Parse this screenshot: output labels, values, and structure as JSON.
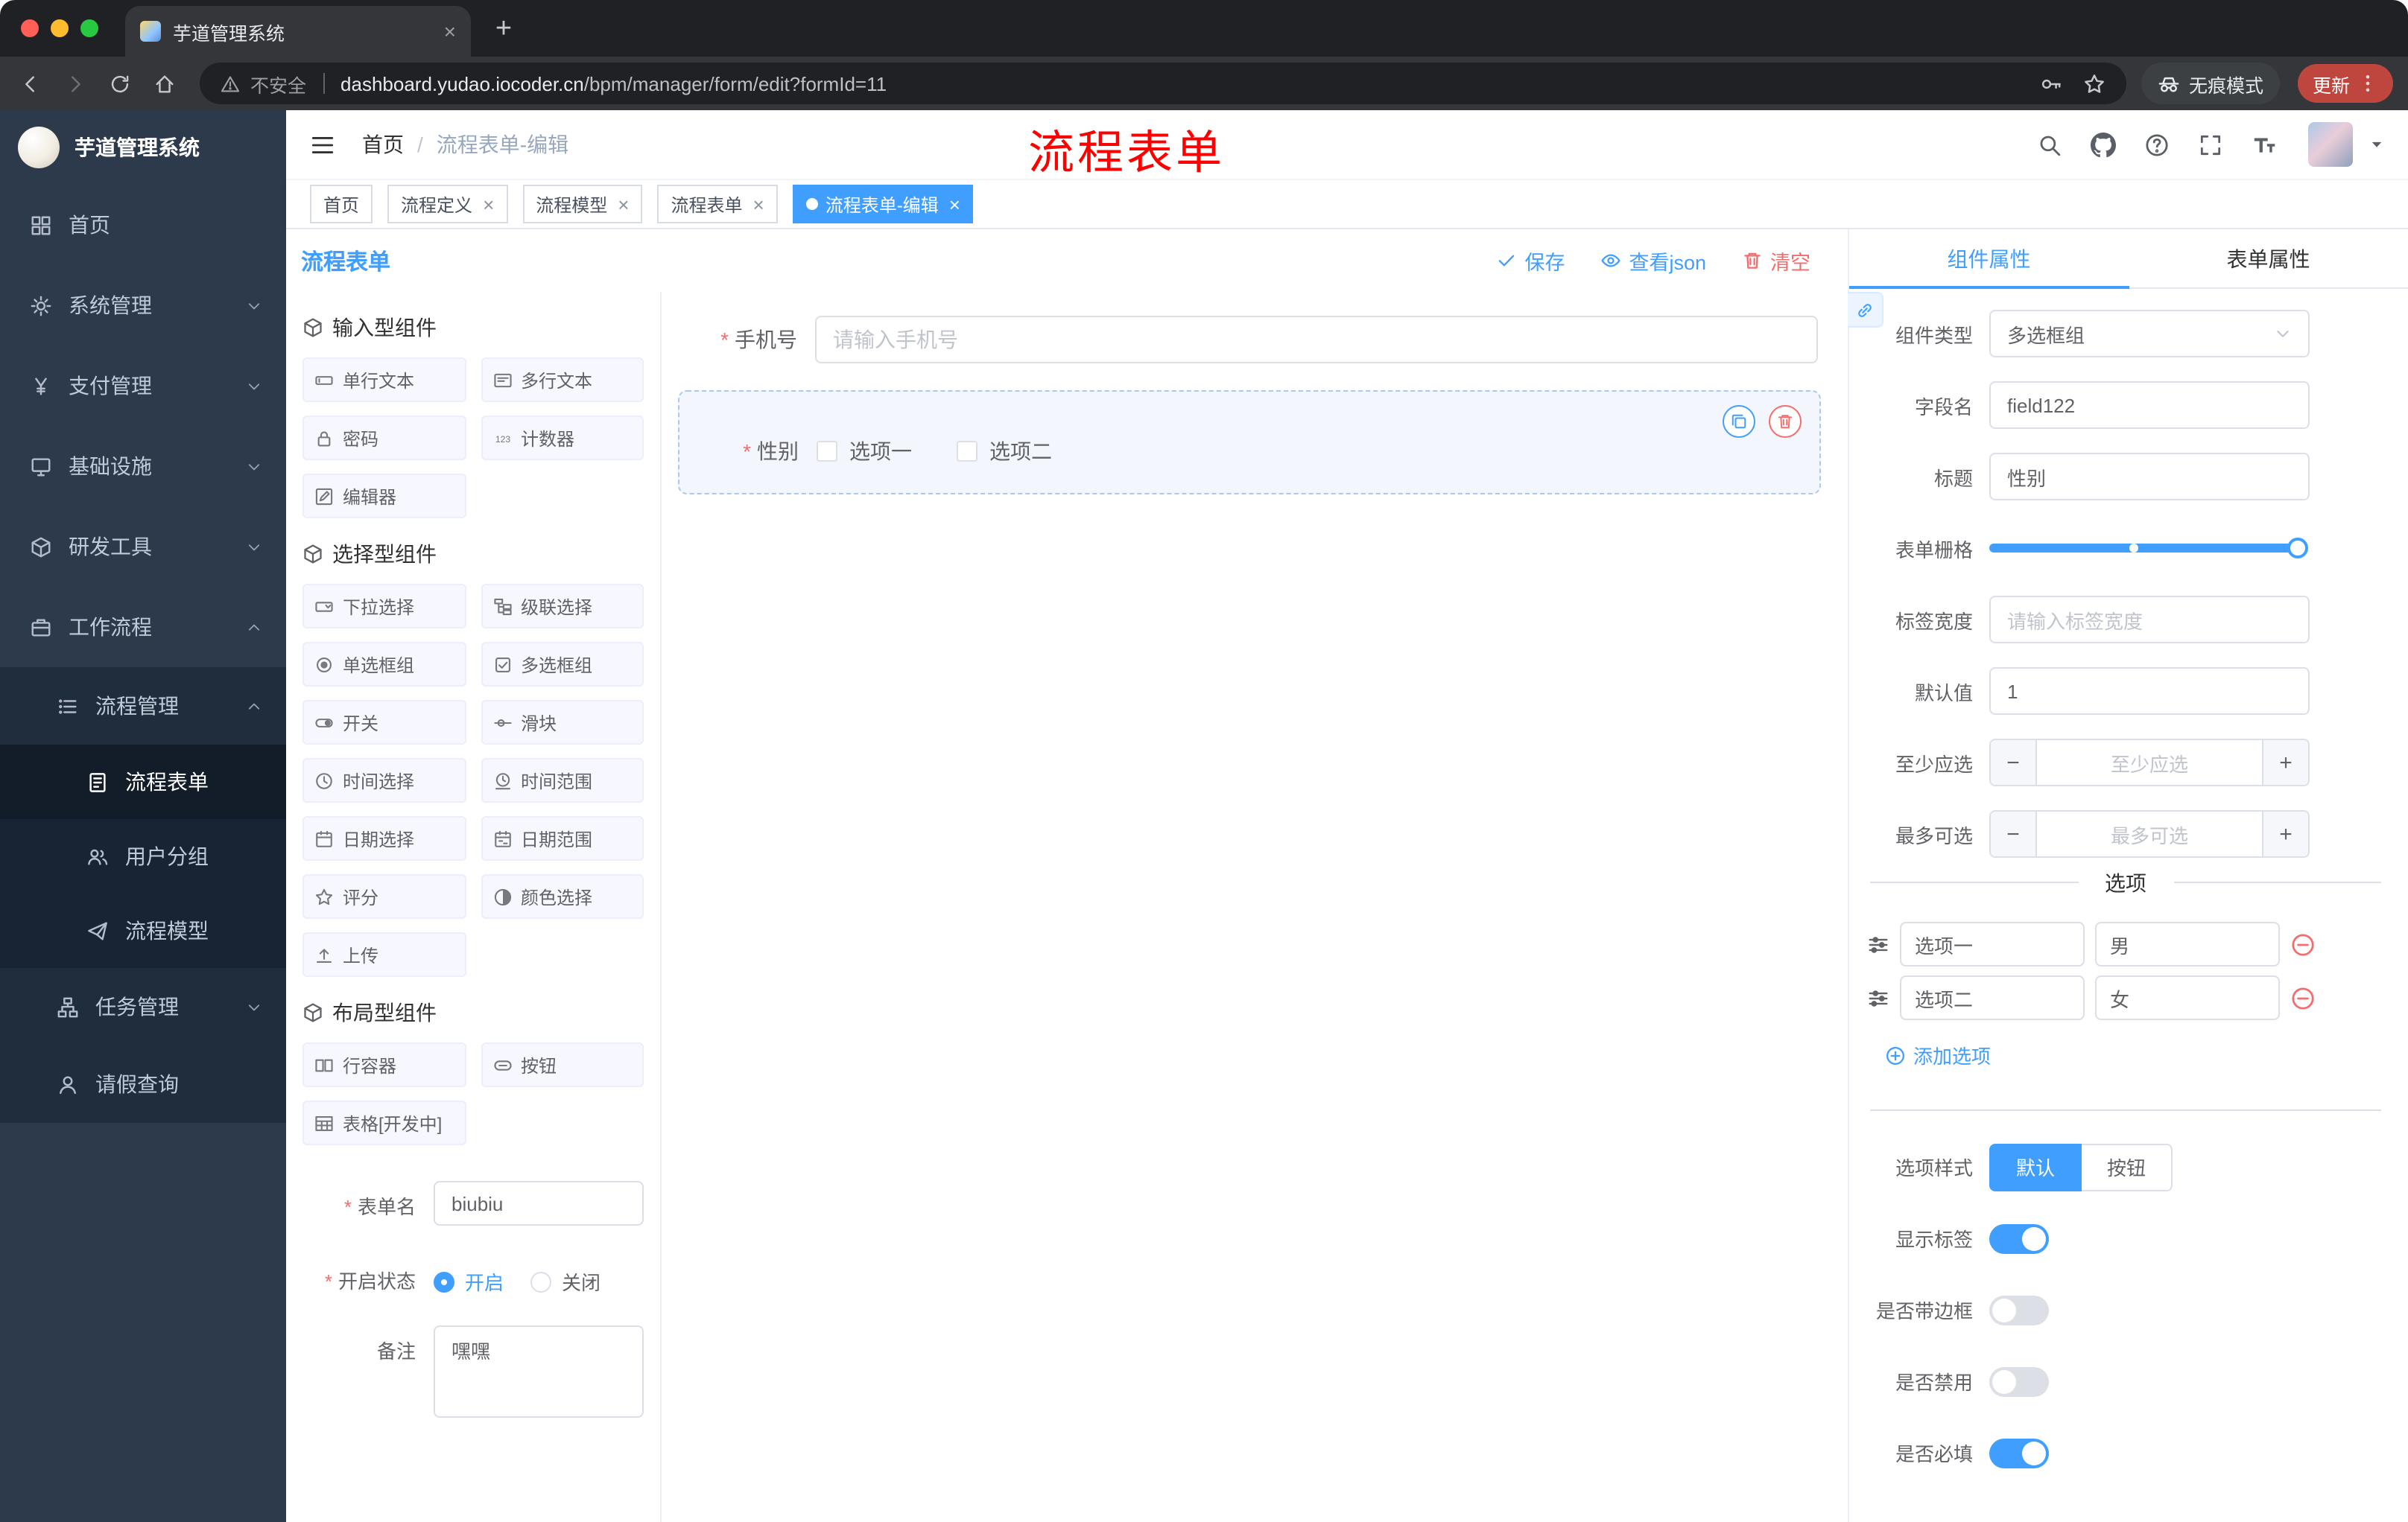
{
  "colors": {
    "accent": "#409eff",
    "danger": "#f56c6c",
    "annotation_red": "#ff0000",
    "sidebar_bg": "#2d3a4b",
    "active_tag_bg": "#409eff",
    "update_pill_bg": "#bf463e"
  },
  "browser": {
    "tab": {
      "title": "芋道管理系统"
    },
    "nav_icons": [
      "back-icon",
      "forward-icon",
      "reload-icon",
      "home-icon"
    ],
    "omnibox": {
      "security_label": "不安全",
      "host": "dashboard.yudao.iocoder.cn",
      "path": "/bpm/manager/form/edit?formId=11",
      "right_icons": [
        "key-icon",
        "star-icon"
      ]
    },
    "incognito_label": "无痕模式",
    "update_label": "更新"
  },
  "sidebar": {
    "logo_title": "芋道管理系统",
    "items": [
      {
        "id": "home",
        "label": "首页",
        "icon": "dashboard-icon",
        "level": 1
      },
      {
        "id": "system-management",
        "label": "系统管理",
        "icon": "gear-icon",
        "level": 1,
        "chevron": "down"
      },
      {
        "id": "payment-management",
        "label": "支付管理",
        "icon": "yen-icon",
        "level": 1,
        "chevron": "down"
      },
      {
        "id": "infrastructure",
        "label": "基础设施",
        "icon": "monitor-icon",
        "level": 1,
        "chevron": "down"
      },
      {
        "id": "dev-tools",
        "label": "研发工具",
        "icon": "cube-icon",
        "level": 1,
        "chevron": "down"
      },
      {
        "id": "workflow",
        "label": "工作流程",
        "icon": "briefcase-icon",
        "level": 1,
        "chevron": "up"
      },
      {
        "id": "process-management",
        "label": "流程管理",
        "icon": "list-icon",
        "level": 2,
        "chevron": "up"
      },
      {
        "id": "process-form",
        "label": "流程表单",
        "icon": "form-icon",
        "level": 3,
        "active": true
      },
      {
        "id": "user-group",
        "label": "用户分组",
        "icon": "users-icon",
        "level": 3
      },
      {
        "id": "process-model",
        "label": "流程模型",
        "icon": "send-icon",
        "level": 3
      },
      {
        "id": "task-management",
        "label": "任务管理",
        "icon": "tree-icon",
        "level": 2,
        "chevron": "down"
      },
      {
        "id": "leave-query",
        "label": "请假查询",
        "icon": "user-icon",
        "level": 2
      }
    ]
  },
  "header": {
    "breadcrumb": [
      "首页",
      "流程表单-编辑"
    ],
    "separator": "/",
    "annotation": "流程表单",
    "right_icons": [
      "search-icon",
      "github-icon",
      "help-icon",
      "fullscreen-icon",
      "fontsize-icon"
    ]
  },
  "tags": [
    {
      "id": "home",
      "label": "首页"
    },
    {
      "id": "process-definition",
      "label": "流程定义",
      "closable": true
    },
    {
      "id": "process-model",
      "label": "流程模型",
      "closable": true
    },
    {
      "id": "process-form",
      "label": "流程表单",
      "closable": true
    },
    {
      "id": "process-form-edit",
      "label": "流程表单-编辑",
      "closable": true,
      "active": true
    }
  ],
  "designer": {
    "title": "流程表单",
    "actions": [
      {
        "id": "save",
        "label": "保存",
        "icon": "check-icon",
        "style": "primary"
      },
      {
        "id": "view-json",
        "label": "查看json",
        "icon": "eye-icon",
        "style": "primary"
      },
      {
        "id": "clear",
        "label": "清空",
        "icon": "trash-icon",
        "style": "danger"
      }
    ],
    "groups": [
      {
        "title": "输入型组件",
        "icon": "cube-icon",
        "items": [
          {
            "id": "single-line-text",
            "label": "单行文本",
            "icon": "input-icon"
          },
          {
            "id": "multi-line-text",
            "label": "多行文本",
            "icon": "textarea-icon"
          },
          {
            "id": "password",
            "label": "密码",
            "icon": "lock-icon"
          },
          {
            "id": "counter",
            "label": "计数器",
            "icon": "number-icon"
          },
          {
            "id": "editor",
            "label": "编辑器",
            "icon": "editor-icon"
          }
        ]
      },
      {
        "title": "选择型组件",
        "icon": "cube-icon",
        "items": [
          {
            "id": "select",
            "label": "下拉选择",
            "icon": "select-icon"
          },
          {
            "id": "cascader",
            "label": "级联选择",
            "icon": "cascader-icon"
          },
          {
            "id": "radio-group",
            "label": "单选框组",
            "icon": "radio-icon"
          },
          {
            "id": "checkbox-group",
            "label": "多选框组",
            "icon": "checkbox-icon"
          },
          {
            "id": "switch",
            "label": "开关",
            "icon": "switch-icon"
          },
          {
            "id": "slider",
            "label": "滑块",
            "icon": "slider-icon"
          },
          {
            "id": "time-picker",
            "label": "时间选择",
            "icon": "time-icon"
          },
          {
            "id": "time-range",
            "label": "时间范围",
            "icon": "time-range-icon"
          },
          {
            "id": "date-picker",
            "label": "日期选择",
            "icon": "date-icon"
          },
          {
            "id": "date-range",
            "label": "日期范围",
            "icon": "date-range-icon"
          },
          {
            "id": "rate",
            "label": "评分",
            "icon": "star-icon"
          },
          {
            "id": "color-picker",
            "label": "颜色选择",
            "icon": "color-icon"
          },
          {
            "id": "upload",
            "label": "上传",
            "icon": "upload-icon"
          }
        ]
      },
      {
        "title": "布局型组件",
        "icon": "cube-icon",
        "items": [
          {
            "id": "row-container",
            "label": "行容器",
            "icon": "row-icon"
          },
          {
            "id": "button",
            "label": "按钮",
            "icon": "button-icon"
          },
          {
            "id": "table",
            "label": "表格[开发中]",
            "icon": "table-icon"
          }
        ]
      }
    ],
    "meta": {
      "name_label": "表单名",
      "name_value": "biubiu",
      "status_label": "开启状态",
      "status_on": "开启",
      "status_off": "关闭",
      "status_checked": "开启",
      "remark_label": "备注",
      "remark_value": "嘿嘿"
    },
    "canvas": {
      "phone_label": "手机号",
      "phone_placeholder": "请输入手机号",
      "gender_label": "性别",
      "gender_options": [
        "选项一",
        "选项二"
      ]
    }
  },
  "props": {
    "tabs": [
      "组件属性",
      "表单属性"
    ],
    "active_tab_index": 0,
    "component_type_label": "组件类型",
    "component_type_value": "多选框组",
    "field_name_label": "字段名",
    "field_name_value": "field122",
    "title_label": "标题",
    "title_value": "性别",
    "grid_label": "表单栅格",
    "label_width_label": "标签宽度",
    "label_width_placeholder": "请输入标签宽度",
    "default_label": "默认值",
    "default_value": "1",
    "min_label": "至少应选",
    "min_placeholder": "至少应选",
    "max_label": "最多可选",
    "max_placeholder": "最多可选",
    "options_title": "选项",
    "options": [
      {
        "name": "选项一",
        "value": "男"
      },
      {
        "name": "选项二",
        "value": "女"
      }
    ],
    "add_option_label": "添加选项",
    "style_label": "选项样式",
    "style_options": [
      "默认",
      "按钮"
    ],
    "style_active": "默认",
    "switches": [
      {
        "id": "show-label",
        "label": "显示标签",
        "on": true
      },
      {
        "id": "with-border",
        "label": "是否带边框",
        "on": false
      },
      {
        "id": "disabled",
        "label": "是否禁用",
        "on": false
      },
      {
        "id": "required",
        "label": "是否必填",
        "on": true
      }
    ]
  }
}
